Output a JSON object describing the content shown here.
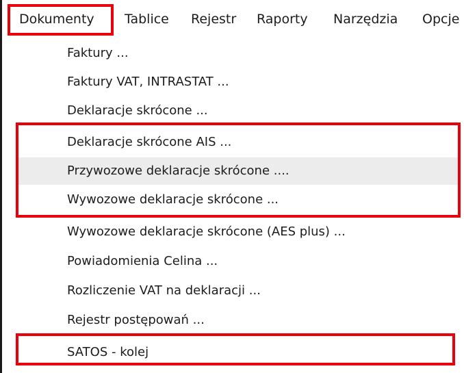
{
  "menubar": {
    "items": [
      {
        "label": "Dokumenty"
      },
      {
        "label": "Tablice"
      },
      {
        "label": "Rejestr"
      },
      {
        "label": "Raporty"
      },
      {
        "label": "Narzędzia"
      },
      {
        "label": "Opcje"
      }
    ]
  },
  "dropdown": {
    "items": [
      {
        "label": "Faktury ..."
      },
      {
        "label": "Faktury VAT,  INTRASTAT ..."
      },
      {
        "label": "Deklaracje skrócone ..."
      },
      {
        "label": "Deklaracje skrócone AIS ..."
      },
      {
        "label": "Przywozowe deklaracje skrócone ...."
      },
      {
        "label": "Wywozowe deklaracje skrócone ..."
      },
      {
        "label": "Wywozowe deklaracje skrócone (AES plus) ..."
      },
      {
        "label": "Powiadomienia Celina ..."
      },
      {
        "label": "Rozliczenie VAT na deklaracji ..."
      },
      {
        "label": "Rejestr postępowań ..."
      },
      {
        "label": "SATOS - kolej"
      }
    ],
    "hovered_item": "Przywozowe deklaracje skrócone ...."
  },
  "annotations": {
    "highlight_color": "#e8000a",
    "highlighted_items": [
      "Dokumenty",
      "Deklaracje skrócone AIS ...",
      "Przywozowe deklaracje skrócone ....",
      "Wywozowe deklaracje skrócone ...",
      "SATOS - kolej"
    ]
  }
}
